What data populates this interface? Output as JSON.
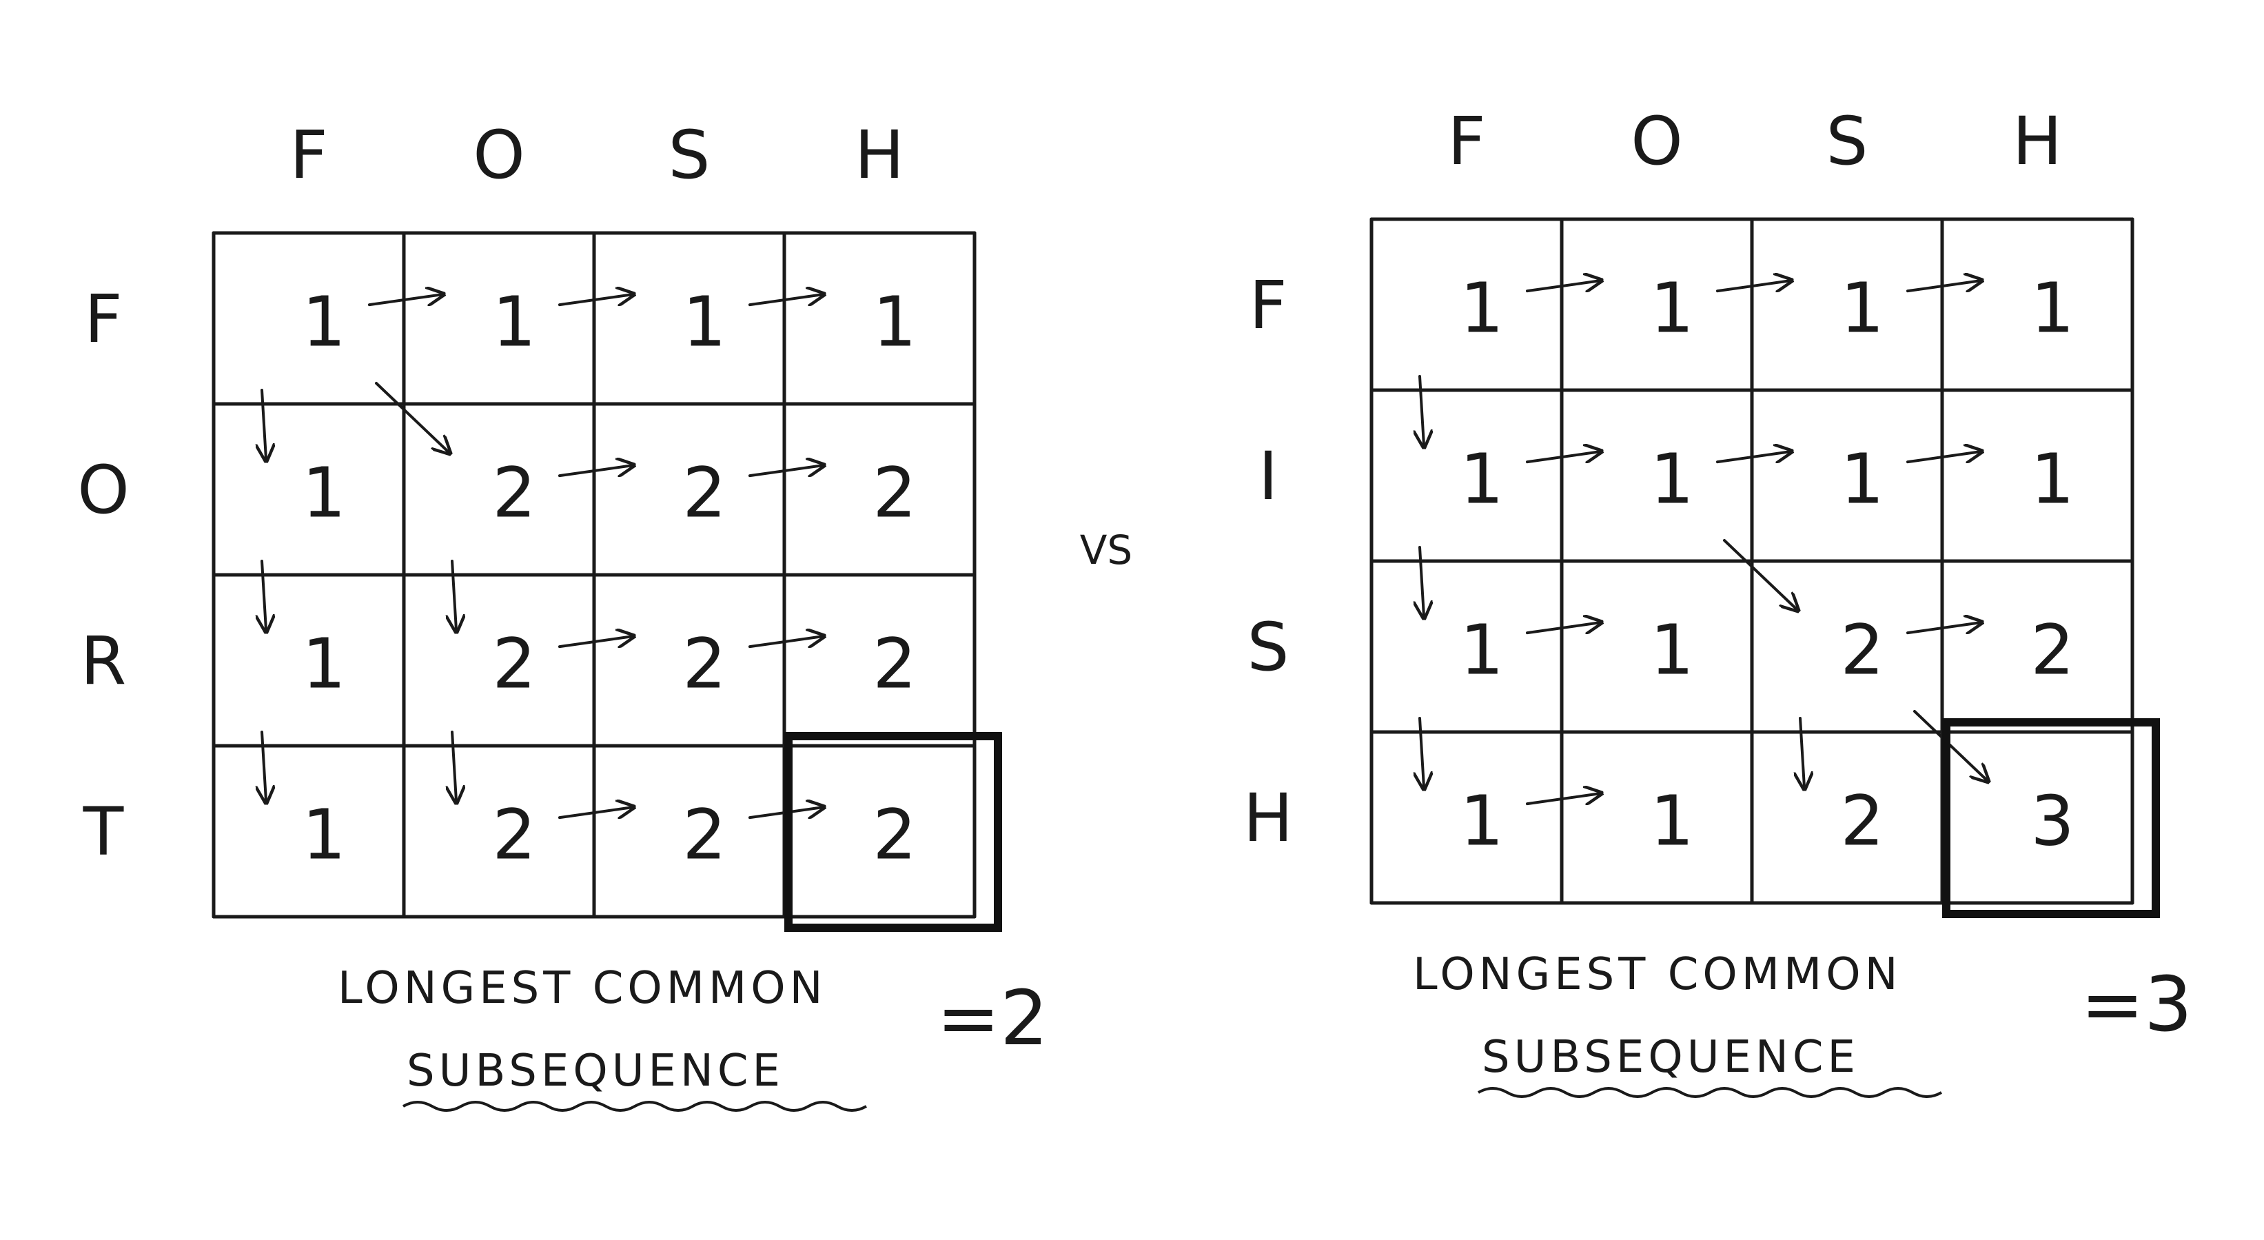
{
  "comparison_label": "VS",
  "grids": [
    {
      "id": "fort",
      "column_letters": [
        "F",
        "O",
        "S",
        "H"
      ],
      "row_letters": [
        "F",
        "O",
        "R",
        "T"
      ],
      "cells": [
        [
          "1",
          "1",
          "1",
          "1"
        ],
        [
          "1",
          "2",
          "2",
          "2"
        ],
        [
          "1",
          "2",
          "2",
          "2"
        ],
        [
          "1",
          "2",
          "2",
          "2"
        ]
      ],
      "arrows": [
        {
          "dir": "right",
          "r": 0,
          "c": 1
        },
        {
          "dir": "right",
          "r": 0,
          "c": 2
        },
        {
          "dir": "right",
          "r": 0,
          "c": 3
        },
        {
          "dir": "down",
          "r": 1,
          "c": 0
        },
        {
          "dir": "diag",
          "r": 1,
          "c": 1
        },
        {
          "dir": "right",
          "r": 1,
          "c": 2
        },
        {
          "dir": "right",
          "r": 1,
          "c": 3
        },
        {
          "dir": "down",
          "r": 2,
          "c": 0
        },
        {
          "dir": "down",
          "r": 2,
          "c": 1
        },
        {
          "dir": "right",
          "r": 2,
          "c": 2
        },
        {
          "dir": "right",
          "r": 2,
          "c": 3
        },
        {
          "dir": "down",
          "r": 3,
          "c": 0
        },
        {
          "dir": "down",
          "r": 3,
          "c": 1
        },
        {
          "dir": "right",
          "r": 3,
          "c": 2
        },
        {
          "dir": "right",
          "r": 3,
          "c": 3
        }
      ],
      "highlight_cell": {
        "r": 3,
        "c": 3
      },
      "caption_line1": "LONGEST COMMON",
      "caption_line2": "SUBSEQUENCE",
      "result": "=2"
    },
    {
      "id": "fish",
      "column_letters": [
        "F",
        "O",
        "S",
        "H"
      ],
      "row_letters": [
        "F",
        "I",
        "S",
        "H"
      ],
      "cells": [
        [
          "1",
          "1",
          "1",
          "1"
        ],
        [
          "1",
          "1",
          "1",
          "1"
        ],
        [
          "1",
          "1",
          "2",
          "2"
        ],
        [
          "1",
          "1",
          "2",
          "3"
        ]
      ],
      "arrows": [
        {
          "dir": "right",
          "r": 0,
          "c": 1
        },
        {
          "dir": "right",
          "r": 0,
          "c": 2
        },
        {
          "dir": "right",
          "r": 0,
          "c": 3
        },
        {
          "dir": "down",
          "r": 1,
          "c": 0
        },
        {
          "dir": "right",
          "r": 1,
          "c": 1
        },
        {
          "dir": "right",
          "r": 1,
          "c": 2
        },
        {
          "dir": "right",
          "r": 1,
          "c": 3
        },
        {
          "dir": "down",
          "r": 2,
          "c": 0
        },
        {
          "dir": "right",
          "r": 2,
          "c": 1
        },
        {
          "dir": "diag",
          "r": 2,
          "c": 2
        },
        {
          "dir": "right",
          "r": 2,
          "c": 3
        },
        {
          "dir": "down",
          "r": 3,
          "c": 0
        },
        {
          "dir": "right",
          "r": 3,
          "c": 1
        },
        {
          "dir": "down",
          "r": 3,
          "c": 2
        },
        {
          "dir": "diag",
          "r": 3,
          "c": 3
        }
      ],
      "highlight_cell": {
        "r": 3,
        "c": 3
      },
      "caption_line1": "LONGEST COMMON",
      "caption_line2": "SUBSEQUENCE",
      "result": "=3"
    }
  ]
}
